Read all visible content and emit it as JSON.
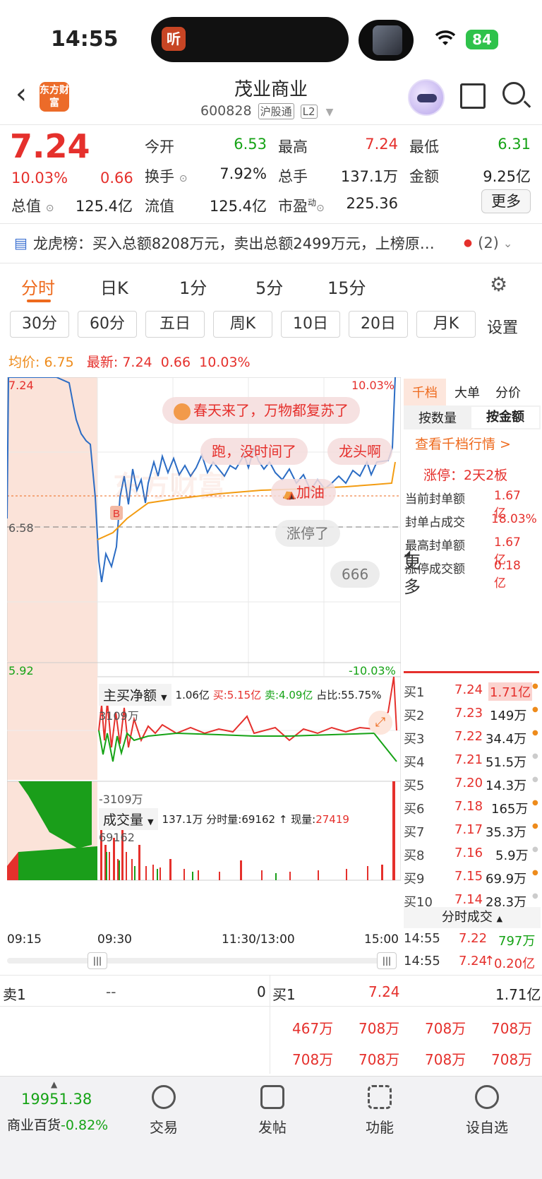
{
  "status": {
    "time": "14:55",
    "listening_app": "听",
    "battery": "84"
  },
  "header": {
    "back_icon": "chevron-left-icon",
    "logo_text": "东方财富",
    "stock_name": "茂业商业",
    "stock_code": "600828",
    "tag_connect": "沪股通",
    "tag_level": "L2"
  },
  "quote": {
    "price": "7.24",
    "change_pct": "10.03%",
    "change": "0.66",
    "labels": {
      "open": "今开",
      "high": "最高",
      "low": "最低",
      "turnover": "换手",
      "volume": "总手",
      "amount": "金额",
      "mcap": "总值",
      "float": "流值",
      "pe": "市盈",
      "pe_sup": "动"
    },
    "open": "6.53",
    "high": "7.24",
    "low": "6.31",
    "turnover": "7.92%",
    "volume": "137.1万",
    "amount": "9.25亿",
    "mcap": "125.4亿",
    "float_mcap": "125.4亿",
    "pe": "225.36",
    "more_btn": "更多"
  },
  "lhb": {
    "label": "龙虎榜：",
    "text": "买入总额8208万元，卖出总额2499万元，上榜原…",
    "count": "(2)"
  },
  "tabs": [
    "分时",
    "日K",
    "1分",
    "5分",
    "15分",
    "更多"
  ],
  "subtabs": [
    "30分",
    "60分",
    "五日",
    "周K",
    "10日",
    "20日",
    "月K",
    "设置"
  ],
  "avg_line": {
    "avg_label": "均价:",
    "avg": "6.75",
    "latest_label": "最新:",
    "latest": "7.24",
    "chg": "0.66",
    "pct": "10.03%"
  },
  "chart_labels": {
    "top_price": "7.24",
    "top_pct": "10.03%",
    "mid_price": "6.58",
    "bot_price": "5.92",
    "bot_pct": "-10.03%",
    "watermark": "东方财富",
    "buy_marker": "B",
    "bubbles": [
      "春天来了，万物都复苏了",
      "跑，没时间了",
      "龙头啊",
      "加油",
      "涨停了",
      "666"
    ]
  },
  "netflow": {
    "title": "主买净额",
    "value": "1.06亿",
    "buy_label": "买:",
    "buy": "5.15亿",
    "sell_label": "卖:",
    "sell": "4.09亿",
    "ratio_label": "占比:",
    "ratio": "55.75%",
    "top": "3109万",
    "bot": "-3109万"
  },
  "volume": {
    "title": "成交量",
    "total": "137.1万",
    "minute_label": "分时量:",
    "minute": "69162",
    "now_label": "现量:",
    "now": "27419",
    "max": "69162"
  },
  "time_axis": [
    "09:15",
    "09:30",
    "11:30/13:00",
    "15:00"
  ],
  "side": {
    "tabs": [
      "千档",
      "大单",
      "分价"
    ],
    "sub_tabs": [
      "按数量",
      "按金额"
    ],
    "link": "查看千档行情 >",
    "limit": "涨停：2天2板",
    "rows": [
      {
        "label": "当前封单额",
        "value": "1.67亿"
      },
      {
        "label": "封单占成交",
        "value": "18.03%"
      },
      {
        "label": "最高封单额",
        "value": "1.67亿"
      },
      {
        "label": "涨停成交额",
        "value": "0.18亿"
      }
    ],
    "book": [
      {
        "label": "买1",
        "price": "7.24",
        "amt": "1.71亿"
      },
      {
        "label": "买2",
        "price": "7.23",
        "amt": "149万"
      },
      {
        "label": "买3",
        "price": "7.22",
        "amt": "34.4万"
      },
      {
        "label": "买4",
        "price": "7.21",
        "amt": "51.5万"
      },
      {
        "label": "买5",
        "price": "7.20",
        "amt": "14.3万"
      },
      {
        "label": "买6",
        "price": "7.18",
        "amt": "165万"
      },
      {
        "label": "买7",
        "price": "7.17",
        "amt": "35.3万"
      },
      {
        "label": "买8",
        "price": "7.16",
        "amt": "5.9万"
      },
      {
        "label": "买9",
        "price": "7.15",
        "amt": "69.9万"
      },
      {
        "label": "买10",
        "price": "7.14",
        "amt": "28.3万"
      }
    ],
    "ticks_title": "分时成交",
    "ticks": [
      {
        "time": "14:55",
        "price": "7.22",
        "vol": "797万"
      },
      {
        "time": "14:55",
        "price": "7.24",
        "vol": "0.20亿"
      }
    ]
  },
  "level1": {
    "sell_label": "卖1",
    "sell_price": "--",
    "sell_vol": "0",
    "buy_label": "买1",
    "buy_price": "7.24",
    "buy_vol": "1.71亿",
    "queue": [
      "467万",
      "708万",
      "708万",
      "708万",
      "708万",
      "708万",
      "708万",
      "708万"
    ]
  },
  "bottom": {
    "index_value": "19951.38",
    "index_name": "商业百货",
    "index_chg": "-0.82%",
    "items": [
      "交易",
      "发帖",
      "功能",
      "设自选"
    ]
  },
  "colors": {
    "up": "#e5302c",
    "down": "#16a316",
    "avg": "#ee8b1b",
    "price_line": "#2b6cc4",
    "accent": "#ee6a1d"
  }
}
